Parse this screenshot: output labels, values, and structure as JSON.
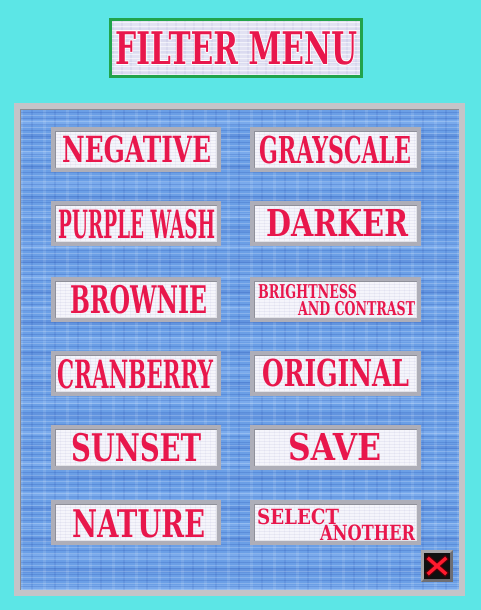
{
  "title": "FILTER MENU",
  "menu": {
    "buttons": [
      {
        "label": "NEGATIVE"
      },
      {
        "label": "GRAYSCALE"
      },
      {
        "label": "PURPLE WASH"
      },
      {
        "label": "DARKER"
      },
      {
        "label": "BROWNIE"
      },
      {
        "lines": [
          "BRIGHTNESS",
          "AND CONTRAST"
        ]
      },
      {
        "label": "CRANBERRY"
      },
      {
        "label": "ORIGINAL"
      },
      {
        "label": "SUNSET"
      },
      {
        "label": "SAVE"
      },
      {
        "label": "NATURE"
      },
      {
        "lines": [
          "SELECT",
          "ANOTHER"
        ]
      }
    ],
    "close_button": {
      "icon": "close-icon"
    }
  },
  "colors": {
    "background": "#5ce6e6",
    "label_red": "#e8174c",
    "title_border": "#22a34b",
    "panel_frame": "#c4c4c8",
    "panel_blue": "#6b9fe6",
    "button_frame": "#aeaeb8",
    "close_bg": "#101010",
    "close_x": "#ff1a2e"
  }
}
